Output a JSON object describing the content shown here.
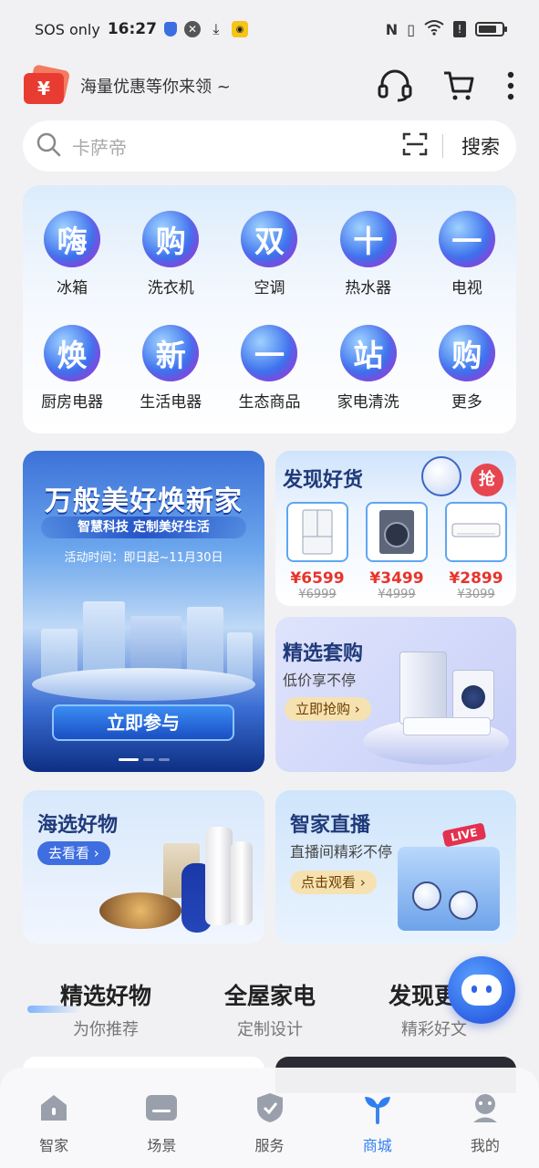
{
  "status_bar": {
    "carrier": "SOS only",
    "time": "16:27",
    "battery_level": 0.8
  },
  "header": {
    "coupon_icon_text": "¥",
    "promo_text": "海量优惠等你来领 ~",
    "icons": [
      "customer-service-icon",
      "cart-icon",
      "more-icon"
    ]
  },
  "search": {
    "placeholder": "卡萨帝",
    "button_label": "搜索"
  },
  "categories": [
    {
      "glyph": "嗨",
      "label": "冰箱"
    },
    {
      "glyph": "购",
      "label": "洗衣机"
    },
    {
      "glyph": "双",
      "label": "空调"
    },
    {
      "glyph": "十",
      "label": "热水器"
    },
    {
      "glyph": "一",
      "label": "电视"
    },
    {
      "glyph": "焕",
      "label": "厨房电器"
    },
    {
      "glyph": "新",
      "label": "生活电器"
    },
    {
      "glyph": "一",
      "label": "生态商品"
    },
    {
      "glyph": "站",
      "label": "家电清洗"
    },
    {
      "glyph": "购",
      "label": "更多"
    }
  ],
  "banner": {
    "title": "万般美好焕新家",
    "subtitle": "智慧科技  定制美好生活",
    "time": "活动时间：即日起~11月30日",
    "cta": "立即参与"
  },
  "deals": {
    "title": "发现好货",
    "badge": "抢",
    "products": [
      {
        "name": "fridge",
        "price": "¥6599",
        "original": "¥6999"
      },
      {
        "name": "washer",
        "price": "¥3499",
        "original": "¥4999"
      },
      {
        "name": "air-conditioner",
        "price": "¥2899",
        "original": "¥3099"
      }
    ]
  },
  "bundle": {
    "title": "精选套购",
    "subtitle": "低价享不停",
    "button": "立即抢购 ›"
  },
  "picks": {
    "title": "海选好物",
    "button": "去看看 ›"
  },
  "live": {
    "title": "智家直播",
    "subtitle": "直播间精彩不停",
    "button": "点击观看 ›",
    "tag": "LIVE"
  },
  "section_tabs": [
    {
      "title": "精选好物",
      "sub": "为你推荐",
      "active": true
    },
    {
      "title": "全屋家电",
      "sub": "定制设计",
      "active": false
    },
    {
      "title": "发现更多",
      "sub": "精彩好文",
      "active": false
    }
  ],
  "bottom_nav": [
    {
      "label": "智家",
      "icon": "house-icon"
    },
    {
      "label": "场景",
      "icon": "scene-icon"
    },
    {
      "label": "服务",
      "icon": "shield-icon"
    },
    {
      "label": "商城",
      "icon": "sprout-icon",
      "active": true
    },
    {
      "label": "我的",
      "icon": "profile-icon"
    }
  ],
  "colors": {
    "accent": "#2e7ef0",
    "price_red": "#e8342a",
    "title_navy": "#203a7a"
  }
}
